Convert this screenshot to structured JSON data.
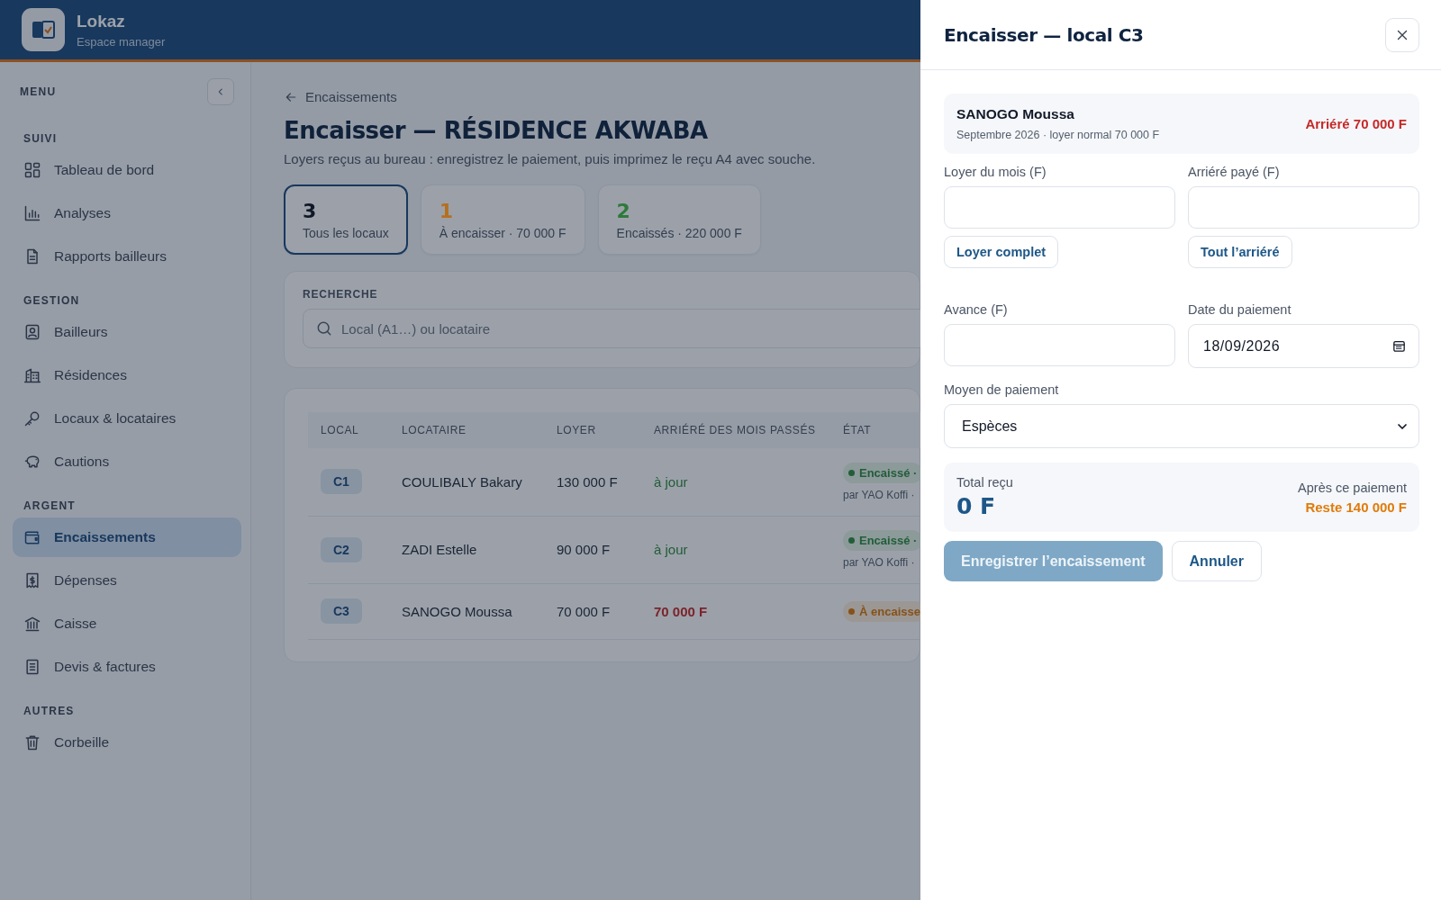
{
  "app": {
    "name": "Lokaz",
    "subtitle": "Espace manager"
  },
  "sidebar": {
    "title": "MENU",
    "sections": [
      {
        "heading": "SUIVI",
        "items": [
          {
            "label": "Tableau de bord",
            "selected": false
          },
          {
            "label": "Analyses",
            "selected": false
          },
          {
            "label": "Rapports bailleurs",
            "selected": false
          }
        ]
      },
      {
        "heading": "GESTION",
        "items": [
          {
            "label": "Bailleurs",
            "selected": false
          },
          {
            "label": "Résidences",
            "selected": false
          },
          {
            "label": "Locaux & locataires",
            "selected": false
          },
          {
            "label": "Cautions",
            "selected": false
          }
        ]
      },
      {
        "heading": "ARGENT",
        "items": [
          {
            "label": "Encaissements",
            "selected": true
          },
          {
            "label": "Dépenses",
            "selected": false
          },
          {
            "label": "Caisse",
            "selected": false
          },
          {
            "label": "Devis & factures",
            "selected": false
          }
        ]
      },
      {
        "heading": "AUTRES",
        "items": [
          {
            "label": "Corbeille",
            "selected": false
          }
        ]
      }
    ]
  },
  "page": {
    "back_link": "Encaissements",
    "title": "Encaisser — RÉSIDENCE AKWABA",
    "subtitle": "Loyers reçus au bureau : enregistrez le paiement, puis imprimez le reçu A4 avec souche.",
    "stats": [
      {
        "value": "3",
        "label": "Tous les locaux",
        "color": "#111827",
        "selected": true
      },
      {
        "value": "1",
        "label": "À encaisser · 70 000 F",
        "color": "#b5701f",
        "selected": false
      },
      {
        "value": "2",
        "label": "Encaissés · 220 000 F",
        "color": "#2d7a3a",
        "selected": false
      }
    ],
    "search": {
      "label": "RECHERCHE",
      "placeholder": "Local (A1…) ou locataire"
    },
    "table": {
      "columns": [
        "LOCAL",
        "LOCATAIRE",
        "LOYER",
        "ARRIÉRÉ DES MOIS PASSÉS",
        "ÉTAT"
      ],
      "rows": [
        {
          "local": "C1",
          "tenant": "COULIBALY Bakary",
          "rent": "130 000 F",
          "arrears": {
            "text": "à jour",
            "kind": "clear"
          },
          "status": {
            "text": "Encaissé ·",
            "kind": "paid",
            "note": "par YAO Koffi ·"
          }
        },
        {
          "local": "C2",
          "tenant": "ZADI Estelle",
          "rent": "90 000 F",
          "arrears": {
            "text": "à jour",
            "kind": "clear"
          },
          "status": {
            "text": "Encaissé ·",
            "kind": "paid",
            "note": "par YAO Koffi ·"
          }
        },
        {
          "local": "C3",
          "tenant": "SANOGO Moussa",
          "rent": "70 000 F",
          "arrears": {
            "text": "70 000 F",
            "kind": "overdue"
          },
          "status": {
            "text": "À encaisse",
            "kind": "due"
          }
        }
      ]
    }
  },
  "drawer": {
    "title": "Encaisser — local C3",
    "tenant": {
      "name": "SANOGO Moussa",
      "detail": "Septembre 2026 · loyer normal 70 000 F",
      "arrears": "Arriéré 70 000 F"
    },
    "fields": [
      {
        "label": "Loyer du mois (F)",
        "kind": "number",
        "quick": "Loyer complet"
      },
      {
        "label": "Arriéré payé (F)",
        "kind": "number",
        "quick": "Tout l’arriéré"
      },
      {
        "label": "Avance (F)",
        "kind": "number"
      },
      {
        "label": "Date du paiement",
        "kind": "date",
        "value": "18/09/2026"
      },
      {
        "label": "Moyen de paiement",
        "kind": "select",
        "value": "Espèces"
      }
    ],
    "total": {
      "label": "Total reçu",
      "value": "0 F",
      "after_label": "Après ce paiement",
      "remaining": "Reste 140 000 F"
    },
    "buttons": [
      {
        "label": "Enregistrer l’encaissement",
        "kind": "primary",
        "disabled": true
      },
      {
        "label": "Annuler",
        "kind": "secondary",
        "disabled": false
      }
    ]
  }
}
